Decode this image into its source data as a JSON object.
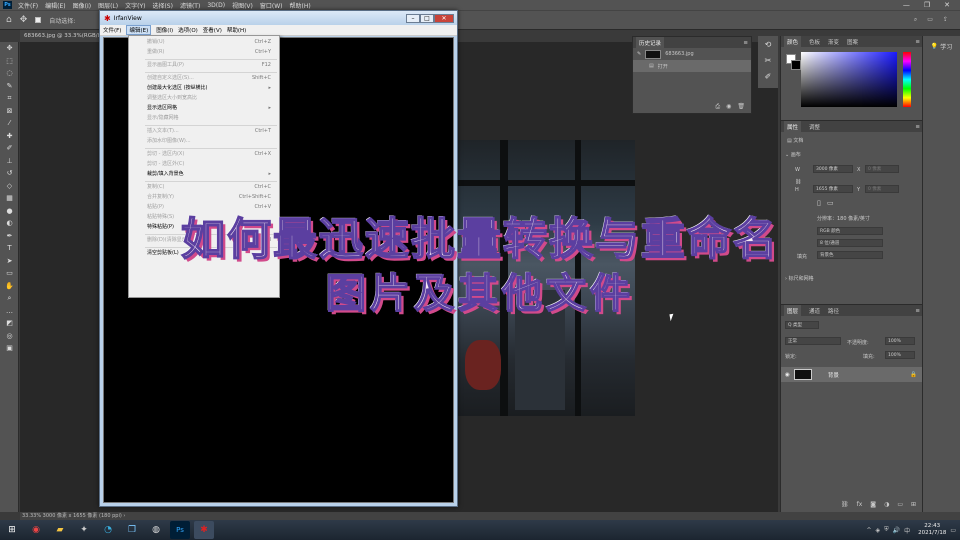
{
  "ps": {
    "menu": [
      "文件(F)",
      "编辑(E)",
      "图像(I)",
      "图层(L)",
      "文字(Y)",
      "选择(S)",
      "滤镜(T)",
      "3D(D)",
      "视图(V)",
      "窗口(W)",
      "帮助(H)"
    ],
    "logo": "Ps",
    "options_label": "自动选择:",
    "doc_tab": "683663.jpg @ 33.3%(RGB/8#)",
    "status": "33.33%   3000 像素 x 1655 像素 (180 ppi)   ›"
  },
  "history": {
    "tabs": [
      "历史记录"
    ],
    "snapshot": "683663.jpg",
    "step": "打开"
  },
  "color_panel": {
    "tabs": [
      "颜色",
      "色板",
      "渐变",
      "图案"
    ],
    "fg": "#ffffff",
    "bg": "#000000"
  },
  "properties": {
    "tabs": [
      "属性",
      "调整"
    ],
    "type": "文档",
    "section_canvas": "画布",
    "w_label": "W",
    "w_value": "3000 像素",
    "x_label": "X",
    "x_placeholder": "0 像素",
    "h_label": "H",
    "h_value": "1655 像素",
    "y_label": "Y",
    "y_placeholder": "0 像素",
    "resolution": "分辨率：180 像素/英寸",
    "mode": "RGB 颜色",
    "depth": "8 位/通道",
    "fill_label": "填充",
    "fill_value": "背景色",
    "section_rulers": "标尺和网格"
  },
  "layers": {
    "tabs": [
      "图层",
      "通道",
      "路径"
    ],
    "filter_value": "Q 类型",
    "blend": "正常",
    "opacity_label": "不透明度:",
    "opacity": "100%",
    "lock_label": "锁定:",
    "fill_label": "填充:",
    "fill": "100%",
    "layer_name": "背景"
  },
  "learn": {
    "label": "学习"
  },
  "irfan": {
    "title": "IrfanView",
    "menu": [
      "文件(F)",
      "编辑(E)",
      "图像(I)",
      "选项(O)",
      "查看(V)",
      "帮助(H)"
    ],
    "edit_items": [
      {
        "label": "撤销(U)",
        "shortcut": "Ctrl+Z",
        "dis": true
      },
      {
        "label": "重做(R)",
        "shortcut": "Ctrl+Y",
        "dis": true
      },
      {
        "sep": true
      },
      {
        "label": "显示画图工具(P)",
        "shortcut": "F12",
        "dis": true
      },
      {
        "sep": true
      },
      {
        "label": "创建自定义选区(S)...",
        "shortcut": "Shift+C",
        "dis": true
      },
      {
        "label": "创建最大化选区 (按纵横比)",
        "shortcut": "▸",
        "dis": false
      },
      {
        "label": "调整选区大小到宽高比",
        "shortcut": "",
        "dis": true
      },
      {
        "label": "显示选区网格",
        "shortcut": "▸",
        "dis": false
      },
      {
        "label": "显示/隐藏网格",
        "shortcut": "",
        "dis": true
      },
      {
        "sep": true
      },
      {
        "label": "插入文本(T)...",
        "shortcut": "Ctrl+T",
        "dis": true
      },
      {
        "label": "添加水印图像(W)...",
        "shortcut": "",
        "dis": true
      },
      {
        "sep": true
      },
      {
        "label": "剪切 - 选区内(X)",
        "shortcut": "Ctrl+X",
        "dis": true
      },
      {
        "label": "剪切 - 选区外(C)",
        "shortcut": "",
        "dis": true
      },
      {
        "label": "裁剪/填入背景色",
        "shortcut": "▸",
        "dis": false
      },
      {
        "sep": true
      },
      {
        "label": "复制(C)",
        "shortcut": "Ctrl+C",
        "dis": true
      },
      {
        "label": "合并复制(Y)",
        "shortcut": "Ctrl+Shift+C",
        "dis": true
      },
      {
        "label": "粘贴(P)",
        "shortcut": "Ctrl+V",
        "dis": true
      },
      {
        "label": "粘贴特殊(S)",
        "shortcut": "",
        "dis": true
      },
      {
        "label": "特殊粘贴(P)",
        "shortcut": "▸",
        "dis": false
      },
      {
        "sep": true
      },
      {
        "label": "删除(D)(清除显示)",
        "shortcut": "Del",
        "dis": true
      },
      {
        "sep": true
      },
      {
        "label": "清空剪贴板(L)",
        "shortcut": "",
        "dis": false
      }
    ]
  },
  "caption": {
    "line1": "如何最迅速批量转换与重命名",
    "line2": "图片及其他文件"
  },
  "taskbar": {
    "time": "22:43",
    "date": "2021/7/18",
    "ime": "中"
  }
}
